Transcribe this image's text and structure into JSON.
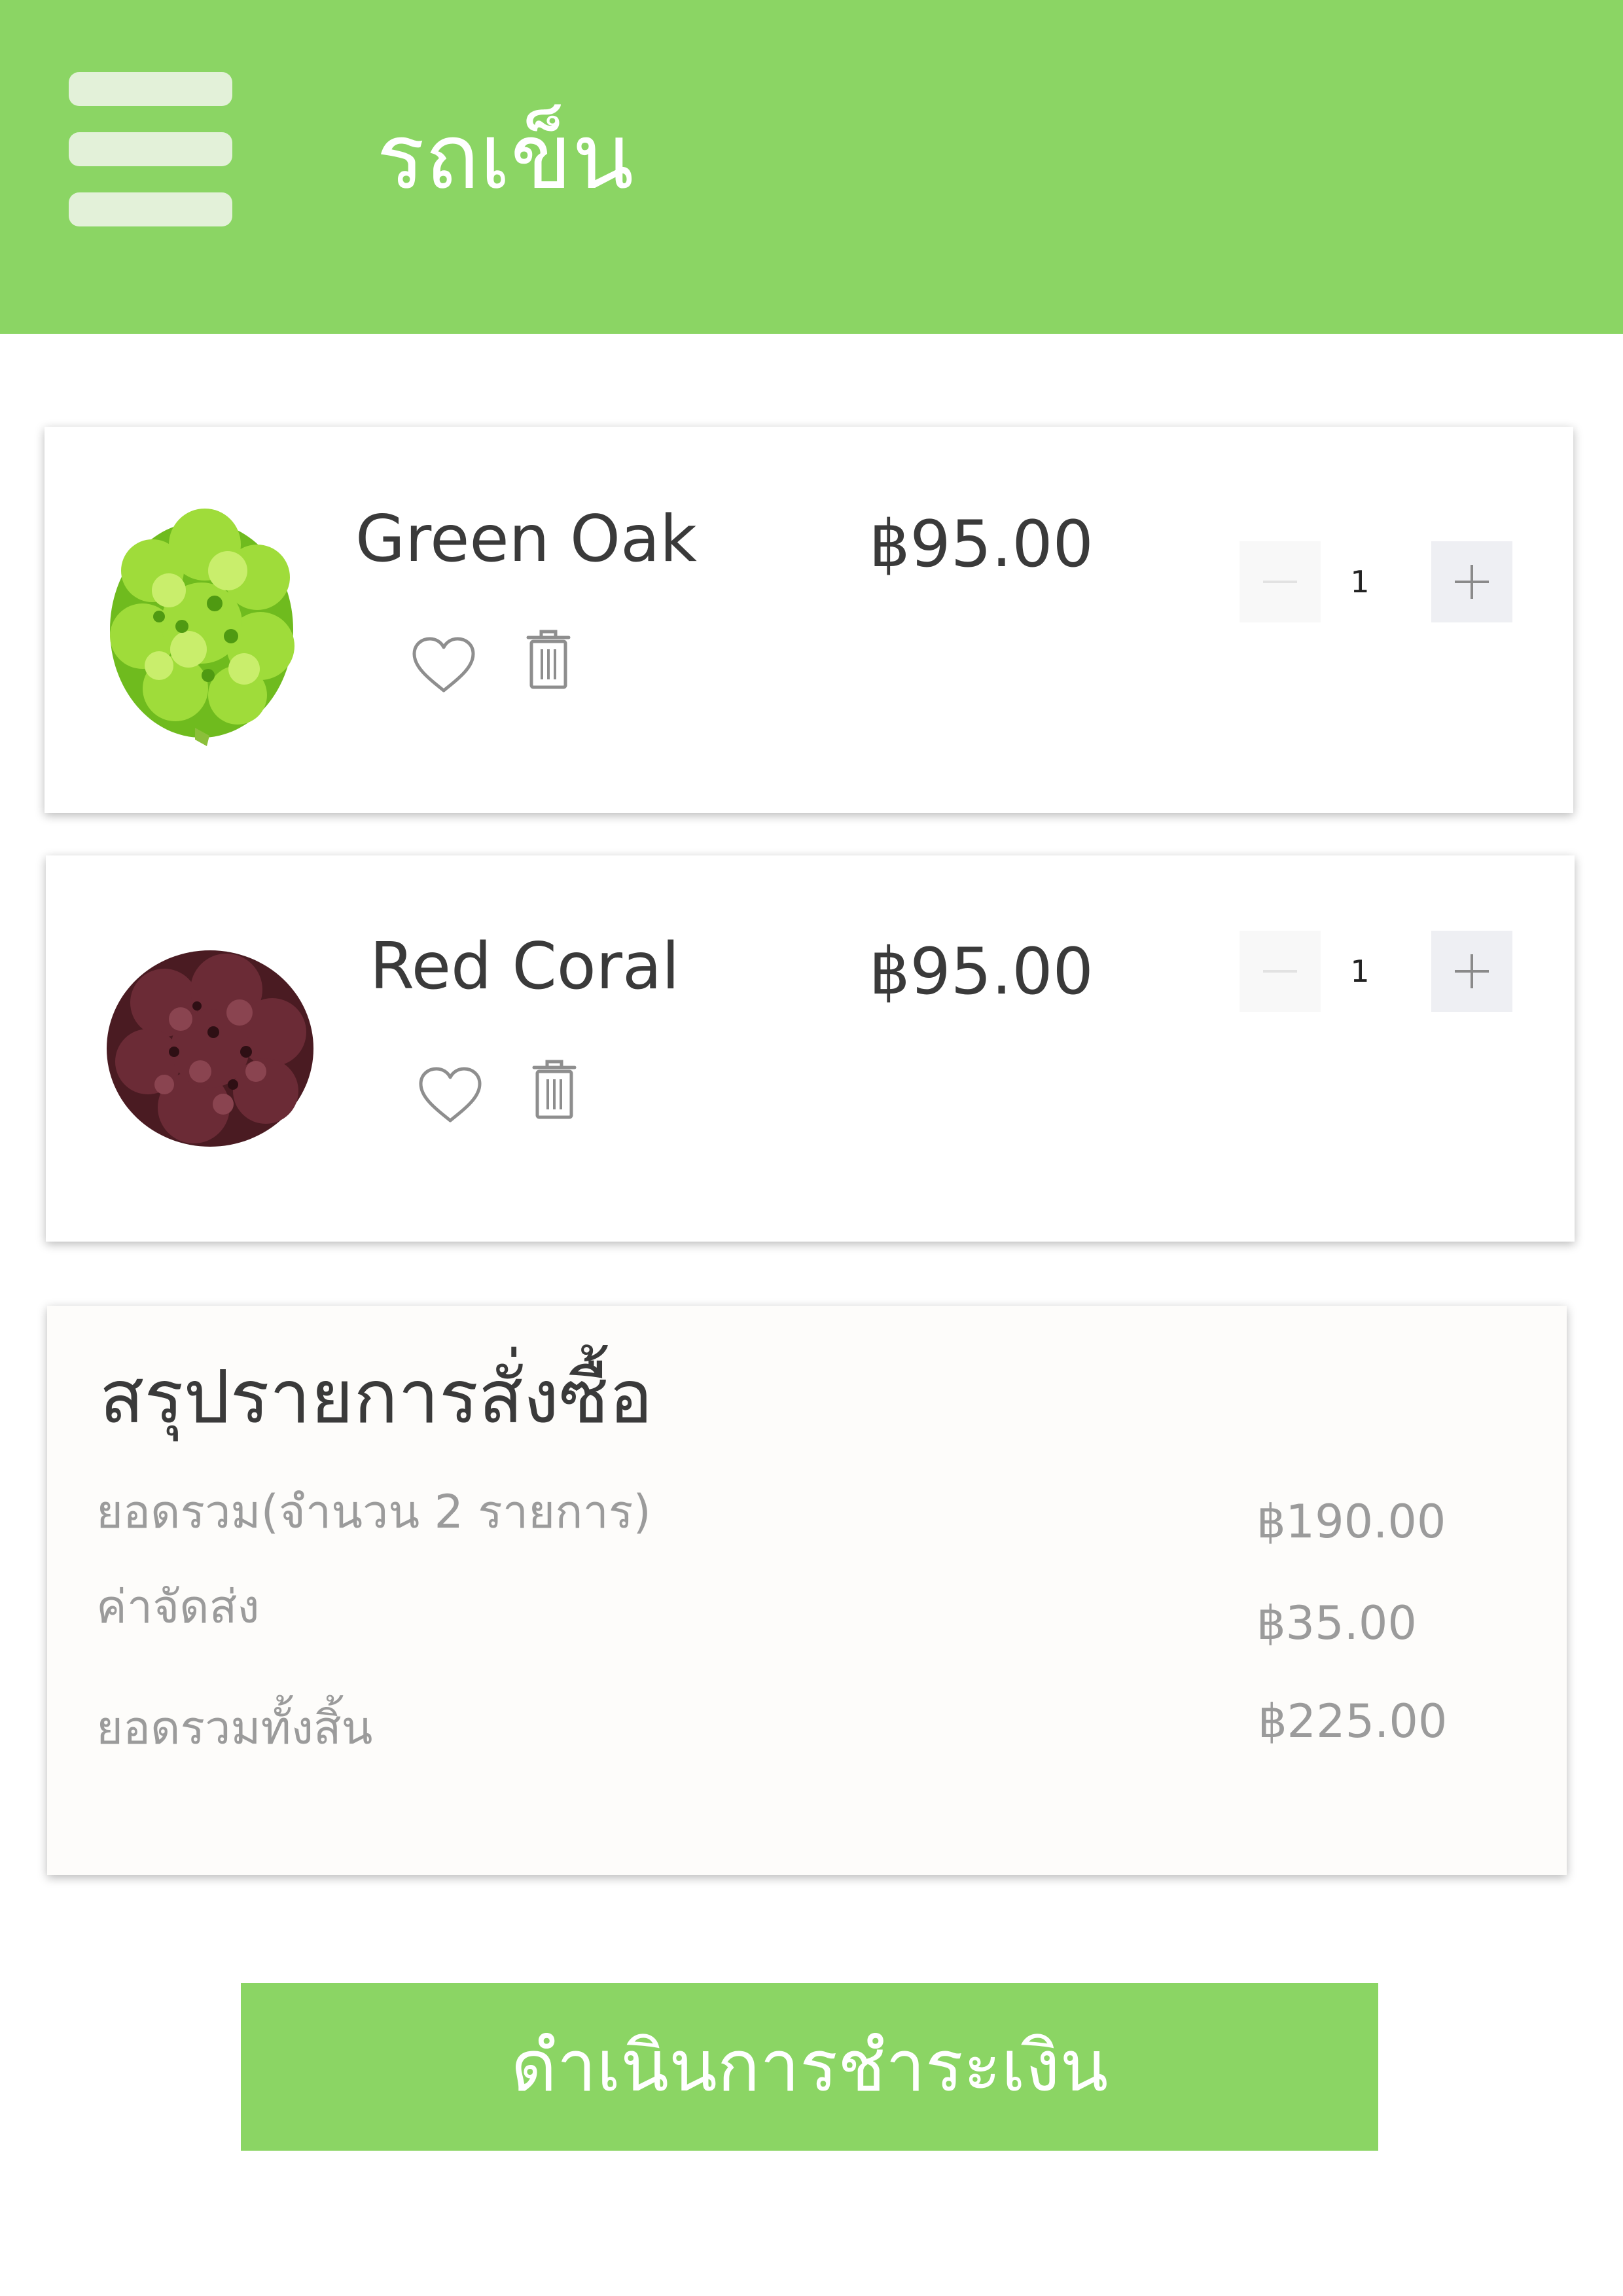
{
  "header": {
    "title": "รถเข็น",
    "menu_icon": "hamburger-menu-icon"
  },
  "cart": {
    "items": [
      {
        "name": "Green Oak",
        "price": "฿95.00",
        "quantity": "1",
        "image": "green-oak-lettuce-image"
      },
      {
        "name": "Red Coral",
        "price": "฿95.00",
        "quantity": "1",
        "image": "red-coral-lettuce-image"
      }
    ],
    "icons": {
      "favorite": "heart-icon",
      "delete": "trash-icon",
      "decrease": "minus-icon",
      "increase": "plus-icon"
    }
  },
  "summary": {
    "title": "สรุปรายการสั่งซื้อ",
    "subtotal_label": "ยอดรวม(จำนวน 2 รายการ)",
    "subtotal_value": "฿190.00",
    "shipping_label": "ค่าจัดส่ง",
    "shipping_value": "฿35.00",
    "total_label": "ยอดรวมทั้งสิ้น",
    "total_value": "฿225.00"
  },
  "checkout": {
    "label": "ดำเนินการชำระเงิน"
  },
  "colors": {
    "accent": "#8bd564",
    "text_primary": "#3a3a3a",
    "text_secondary": "#9b9b9b",
    "menu_bars": "#e3f1d9"
  }
}
